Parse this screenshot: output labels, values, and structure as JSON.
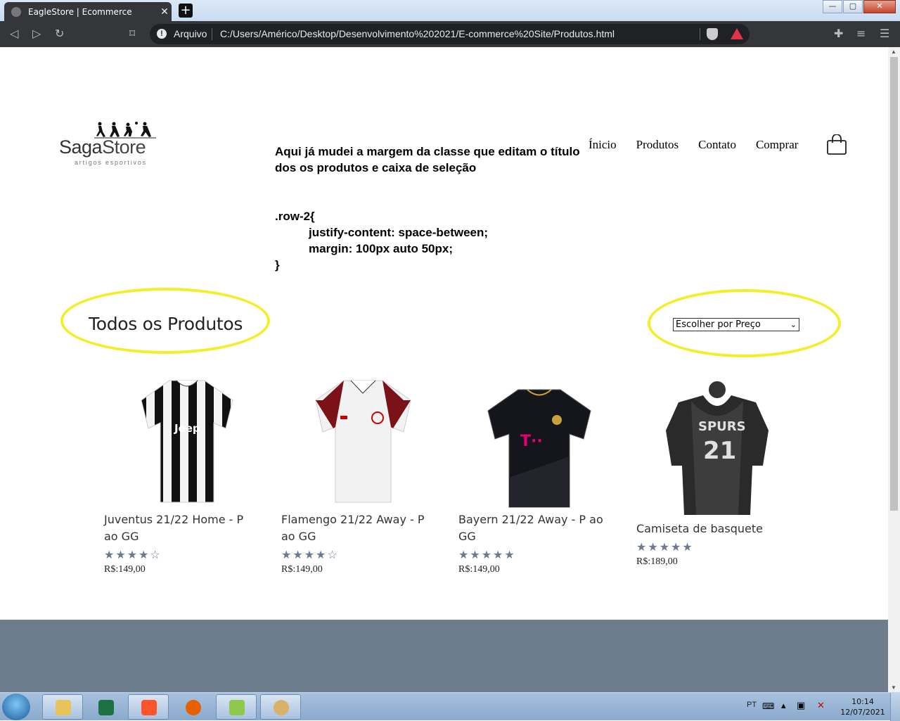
{
  "browser": {
    "tab_title": "EagleStore | Ecommerce",
    "tab_close": "✕",
    "new_tab": "+",
    "scheme_label": "Arquivo",
    "url": "C:/Users/Américo/Desktop/Desenvolvimento%202021/E-commerce%20Site/Produtos.html",
    "window_buttons": [
      "—",
      "▢",
      "✕"
    ]
  },
  "site": {
    "logo_name_first": "Saga",
    "logo_name_second": "Store",
    "logo_tagline": "artigos esportivos",
    "nav": [
      "Ínicio",
      "Produtos",
      "Contato",
      "Comprar"
    ],
    "annotation": "Aqui já mudei a margem da classe que editam o título dos os produtos e caixa de seleção",
    "code_lines": [
      ".row-2{",
      "justify-content: space-between;",
      "margin: 100px auto 50px;",
      "}"
    ],
    "highlight_color": "#f3ee2a",
    "section_title": "Todos os Produtos",
    "sort_select": "Escolher por Preço",
    "products": [
      {
        "name": "Juventus 21/22 Home - P ao GG",
        "stars": "★★★★☆",
        "rating": 4,
        "price": "R$:149,00"
      },
      {
        "name": "Flamengo 21/22 Away - P ao GG",
        "stars": "★★★★☆",
        "rating": 4,
        "price": "R$:149,00"
      },
      {
        "name": "Bayern 21/22 Away - P ao GG",
        "stars": "★★★★★",
        "rating": 5,
        "price": "R$:149,00"
      },
      {
        "name": "Camiseta de basquete",
        "stars": "★★★★★",
        "rating": 5,
        "price": "R$:189,00"
      }
    ],
    "footer_color": "#6d7d8d"
  },
  "taskbar": {
    "lang": "PT",
    "time": "10:14",
    "date": "12/07/2021"
  }
}
